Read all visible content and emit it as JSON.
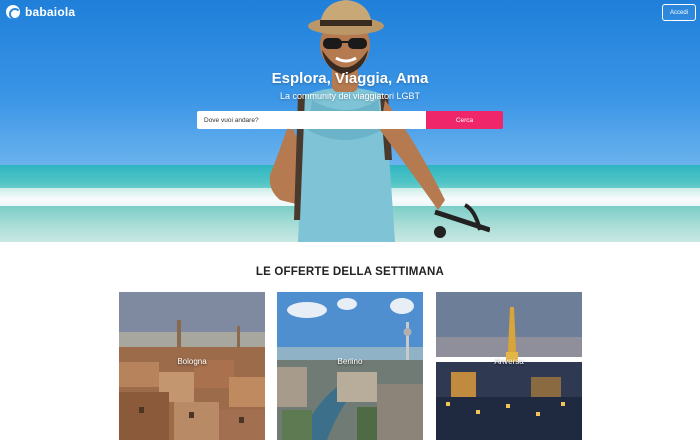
{
  "brand": {
    "name": "babaiola"
  },
  "header": {
    "login_label": "Accedi"
  },
  "hero": {
    "title": "Esplora, Viaggia, Ama",
    "subtitle": "La community dei viaggiatori LGBT",
    "search_placeholder": "Dove vuoi andare?",
    "search_button": "Cerca"
  },
  "offers": {
    "title": "LE OFFERTE DELLA SETTIMANA",
    "cards": [
      {
        "city": "Bologna"
      },
      {
        "city": "Berlino"
      },
      {
        "city": "Anversa"
      }
    ]
  },
  "colors": {
    "accent": "#f0266b",
    "sky": "#2a87dd"
  }
}
